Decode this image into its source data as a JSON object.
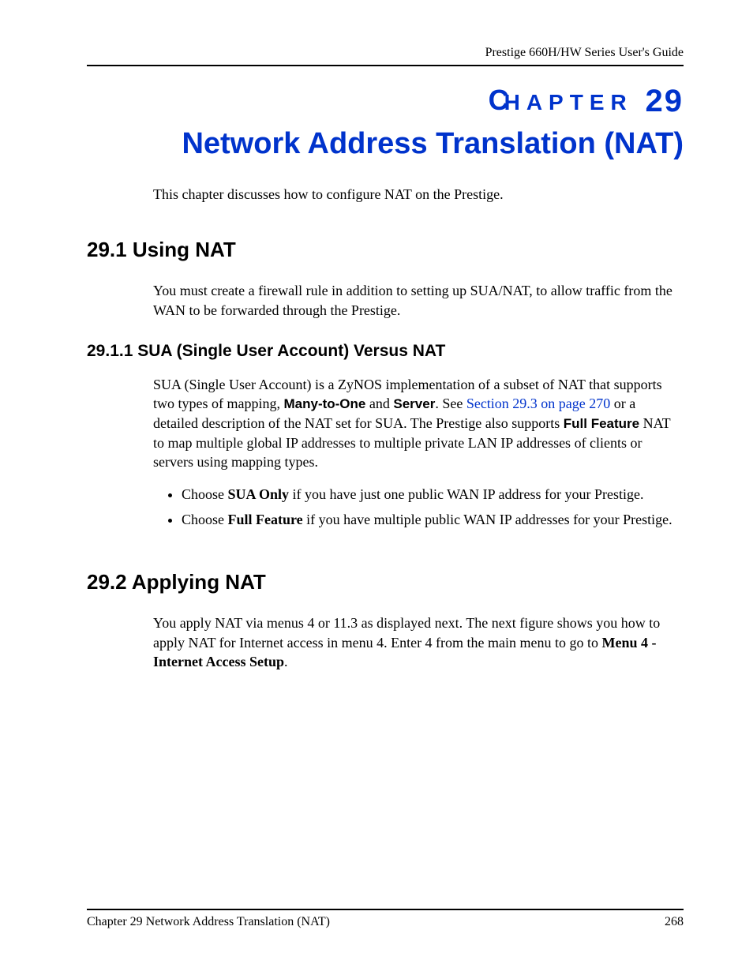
{
  "header": {
    "guide_title": "Prestige 660H/HW Series User's Guide"
  },
  "chapter": {
    "label_prefix_first": "C",
    "label_prefix_rest": "HAPTER",
    "number": "29",
    "title": "Network Address Translation (NAT)"
  },
  "intro": "This chapter discusses how to configure NAT on the Prestige.",
  "sections": {
    "s29_1": {
      "heading": "29.1  Using NAT",
      "para1": "You must create a firewall rule in addition to setting up SUA/NAT, to allow traffic from the WAN to be forwarded through the Prestige.",
      "s29_1_1": {
        "heading": "29.1.1  SUA (Single User Account) Versus NAT",
        "para_parts": {
          "p1": "SUA (Single User Account) is a ZyNOS implementation of a subset of NAT that supports two types of mapping, ",
          "b1": "Many-to-One",
          "p2": " and ",
          "b2": "Server",
          "p3": ". See ",
          "link": "Section 29.3 on page 270",
          "p4": " or a detailed description of the NAT set for SUA. The Prestige also supports ",
          "b3": "Full Feature",
          "p5": " NAT to map multiple global IP addresses to multiple private LAN IP addresses of clients or servers using mapping types."
        },
        "bullets": [
          {
            "pre": "Choose ",
            "bold": "SUA Only",
            "post": " if you have just one public WAN IP address for your Prestige."
          },
          {
            "pre": "Choose ",
            "bold": "Full Feature",
            "post": " if you have multiple public WAN IP addresses for your Prestige."
          }
        ]
      }
    },
    "s29_2": {
      "heading": "29.2  Applying NAT",
      "para_parts": {
        "p1": "You apply NAT via menus 4 or 11.3 as displayed next. The next figure shows you how to apply NAT for Internet access in menu 4. Enter 4 from the main menu to go to ",
        "b1": "Menu 4 - Internet Access Setup",
        "p2": "."
      }
    }
  },
  "footer": {
    "left": "Chapter 29 Network Address Translation (NAT)",
    "right": "268"
  }
}
